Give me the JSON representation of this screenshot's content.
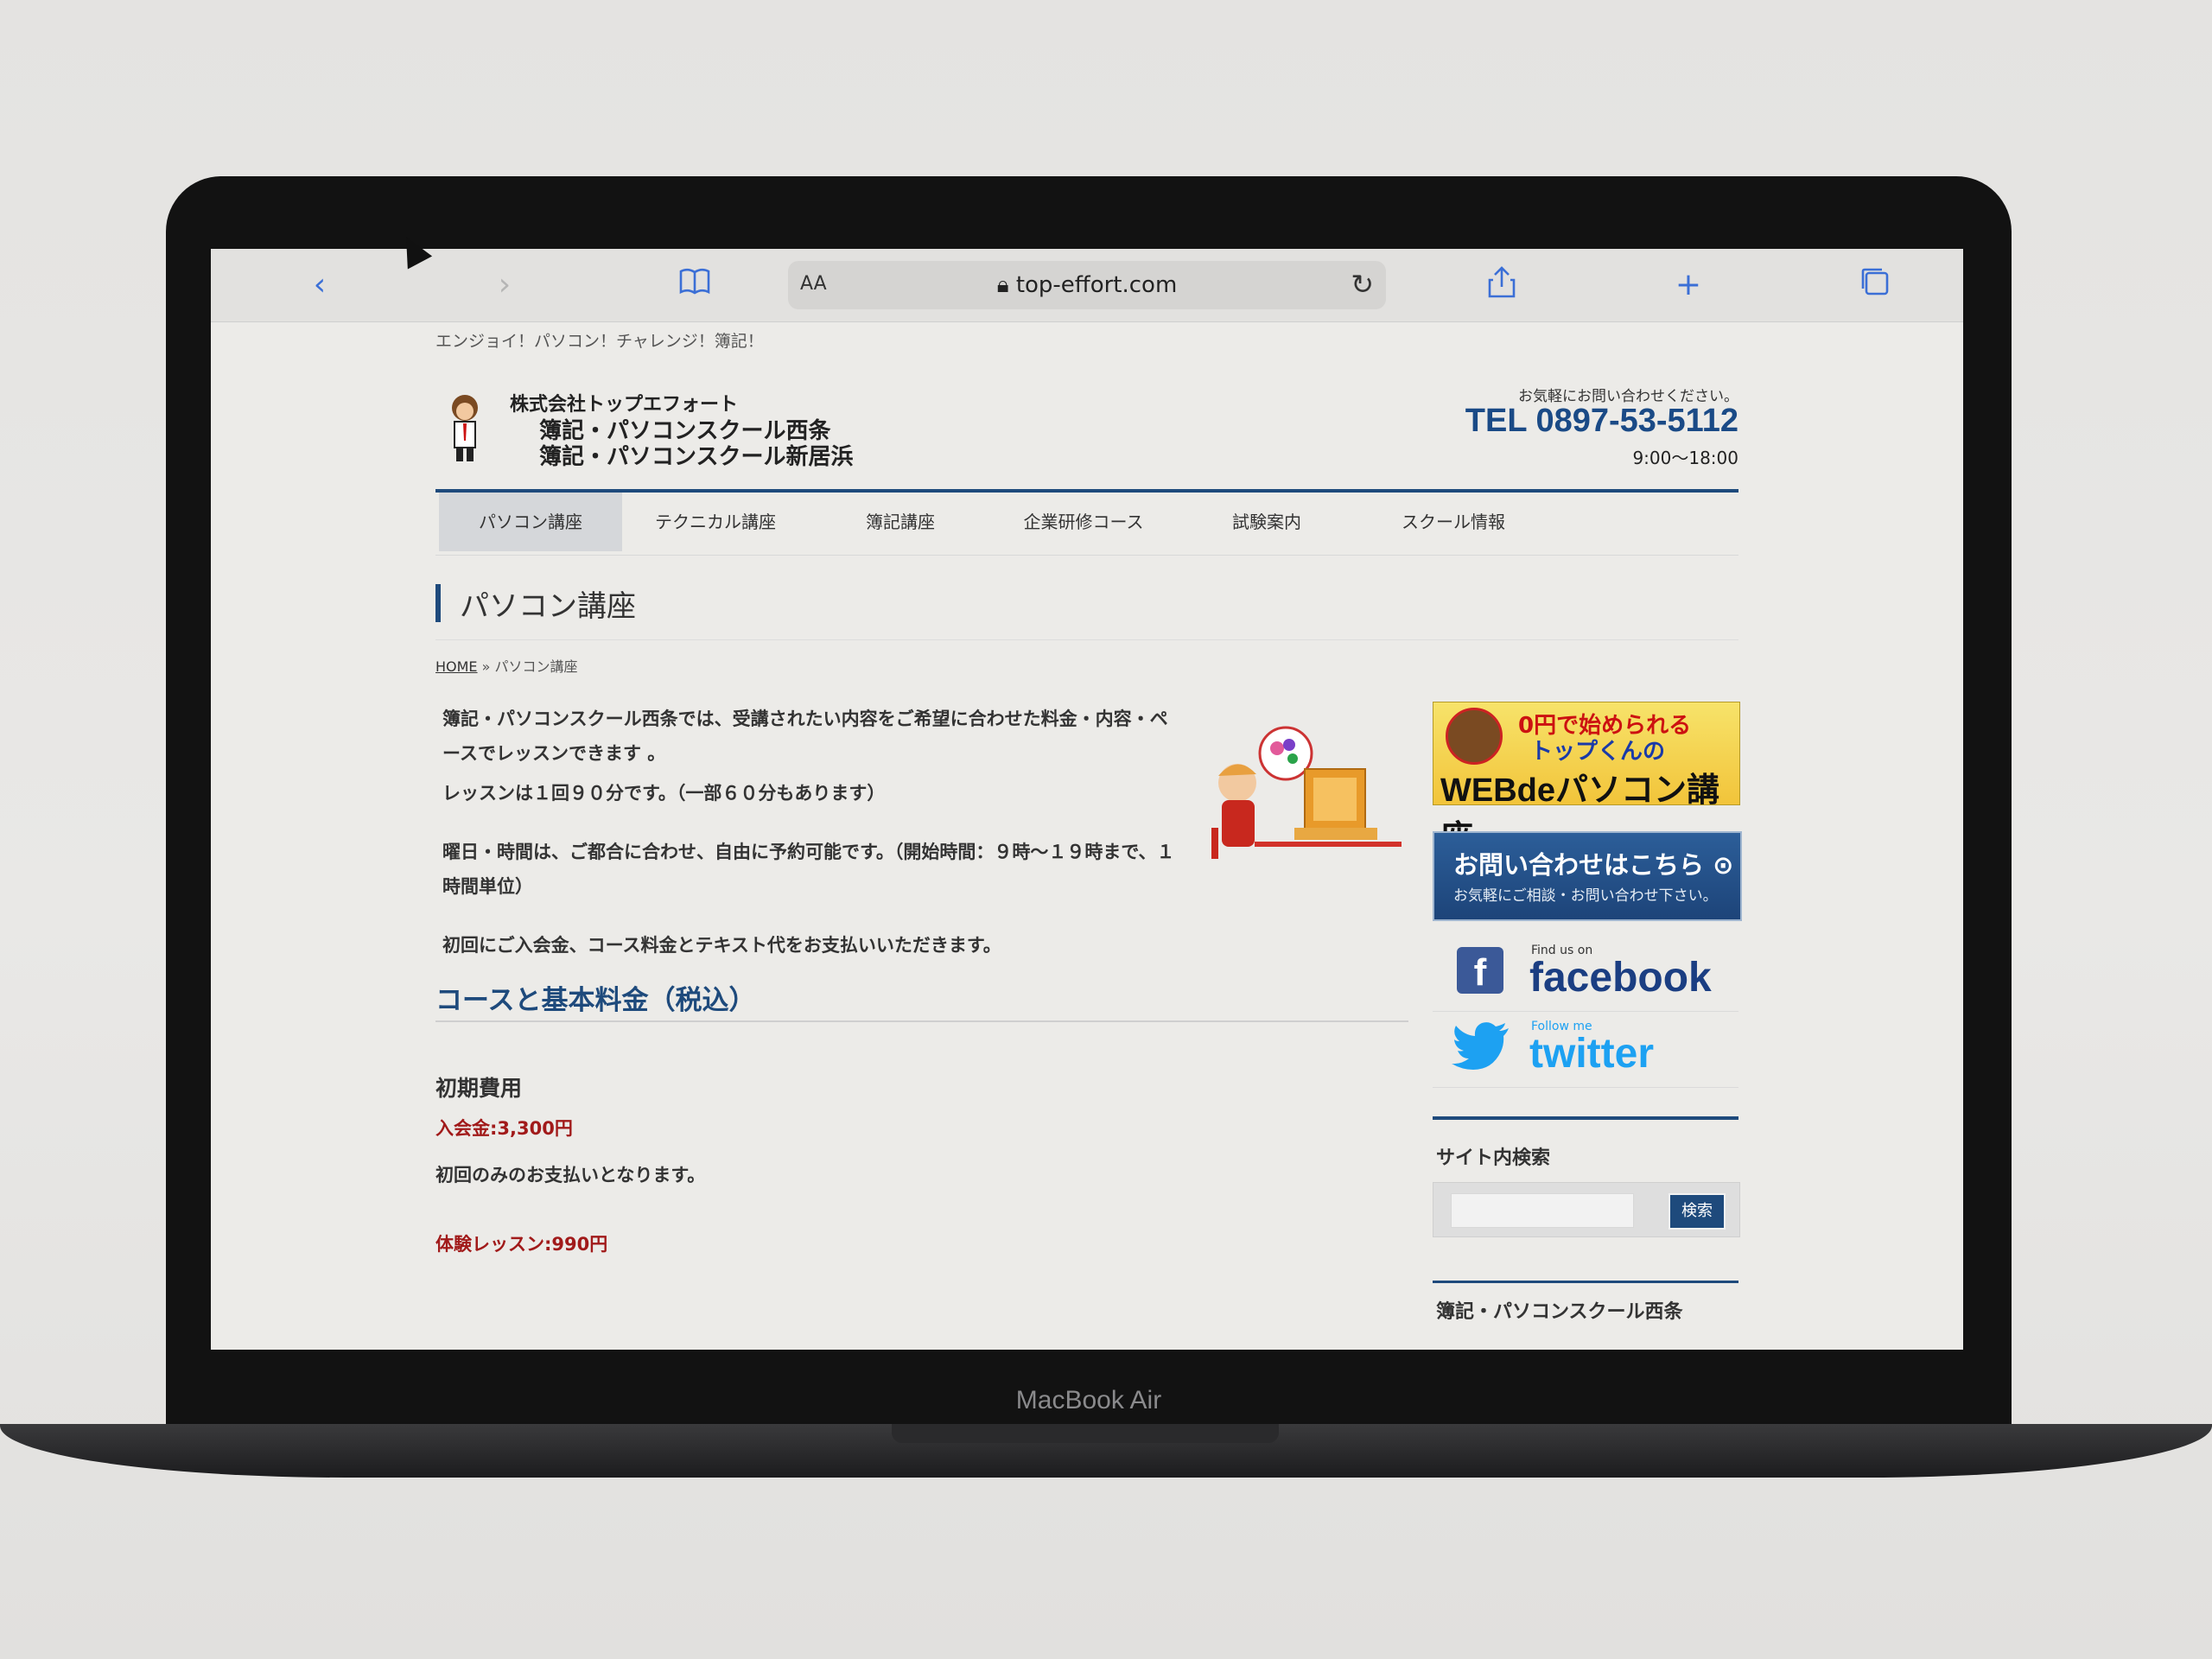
{
  "device": {
    "brand_label": "MacBook Air"
  },
  "browser": {
    "url": "top-effort.com",
    "text_size_label": "AA"
  },
  "header": {
    "tagline": "エンジョイ！パソコン！チャレンジ！簿記！",
    "company": "株式会社トップエフォート",
    "school1": "簿記・パソコンスクール西条",
    "school2": "簿記・パソコンスクール新居浜",
    "contact_note": "お気軽にお問い合わせください。",
    "tel": "TEL 0897-53-5112",
    "hours": "9:00〜18:00"
  },
  "nav": {
    "items": [
      {
        "label": "パソコン講座",
        "active": true
      },
      {
        "label": "テクニカル講座"
      },
      {
        "label": "簿記講座"
      },
      {
        "label": "企業研修コース"
      },
      {
        "label": "試験案内"
      },
      {
        "label": "スクール情報"
      }
    ]
  },
  "page": {
    "title": "パソコン講座",
    "breadcrumb": {
      "home": "HOME",
      "sep": "»",
      "current": "パソコン講座"
    },
    "paragraphs": [
      "簿記・パソコンスクール西条では、受講されたい内容をご希望に合わせた料金・内容・ペースでレッスンできます 。",
      "レッスンは１回９０分です。（一部６０分もあります）",
      "曜日・時間は、ご都合に合わせ、自由に予約可能です。（開始時間：９時〜１９時まで、１時間単位）",
      "初回にご入会金、コース料金とテキスト代をお支払いいただきます。"
    ],
    "section_heading": "コースと基本料金（税込）",
    "sub_heading": "初期費用",
    "enrollment_fee": "入会金:3,300円",
    "enrollment_note": "初回のみのお支払いとなります。",
    "trial_fee": "体験レッスン:990円"
  },
  "sidebar": {
    "web_banner": {
      "line1": "0円で始められる",
      "line2": "トップくんの",
      "line3": "WEBdeパソコン講座"
    },
    "contact_banner": {
      "title": "お問い合わせはこちら ⊙",
      "subtitle": "お気軽にご相談・お問い合わせ下さい。"
    },
    "facebook": {
      "small": "Find us on",
      "big": "facebook"
    },
    "twitter": {
      "small": "Follow me",
      "big": "twitter"
    },
    "search": {
      "heading": "サイト内検索",
      "button": "検索",
      "placeholder": ""
    },
    "next_heading": "簿記・パソコンスクール西条"
  }
}
